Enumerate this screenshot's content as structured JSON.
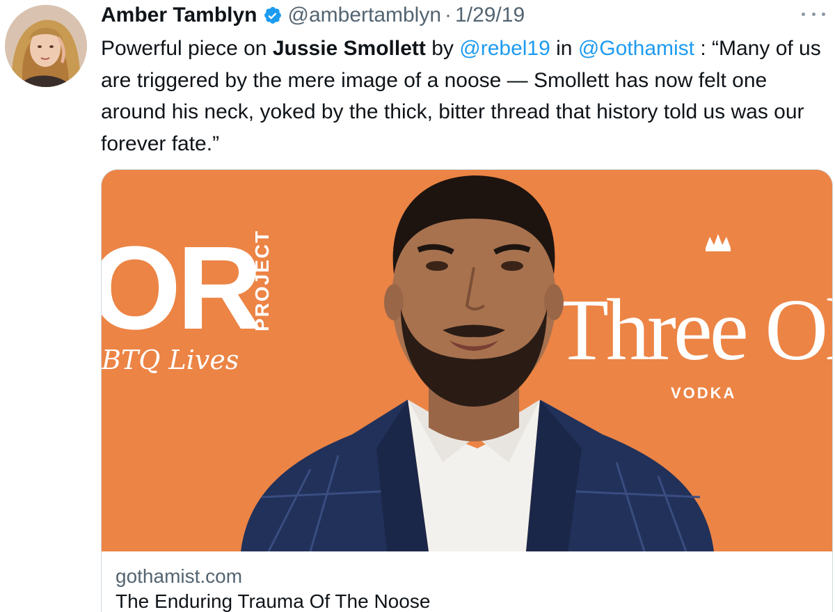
{
  "author": {
    "display_name": "Amber Tamblyn",
    "handle": "@ambertamblyn",
    "date": "1/29/19",
    "separator": "·",
    "verified": true,
    "avatar_icon": "profile-photo"
  },
  "tweet": {
    "segments": [
      {
        "type": "text",
        "text": "Powerful piece on "
      },
      {
        "type": "bold",
        "text": "Jussie Smollett"
      },
      {
        "type": "text",
        "text": " by "
      },
      {
        "type": "mention",
        "text": "@rebel19"
      },
      {
        "type": "text",
        "text": " in "
      },
      {
        "type": "mention",
        "text": "@Gothamist"
      },
      {
        "type": "text",
        "text": " : “Many of us are triggered by the mere image of a noose — Smollett has now felt one around his neck, yoked by the thick, bitter thread that history told us was our forever fate.”"
      }
    ]
  },
  "card": {
    "domain": "gothamist.com",
    "title": "The Enduring Trauma Of The Noose",
    "image": {
      "backdrop_left_big": "OR",
      "backdrop_left_vertical": "PROJECT",
      "backdrop_left_small": "BTQ Lives",
      "backdrop_right_brand": "Three Olives",
      "backdrop_right_sub": "VODKA"
    }
  },
  "colors": {
    "link": "#1d9bf0",
    "secondary_text": "#536471",
    "backdrop": "#ec8445",
    "verified_badge": "#1d9bf0"
  },
  "icons": {
    "verified": "verified-badge-icon",
    "more": "more-options-icon"
  }
}
